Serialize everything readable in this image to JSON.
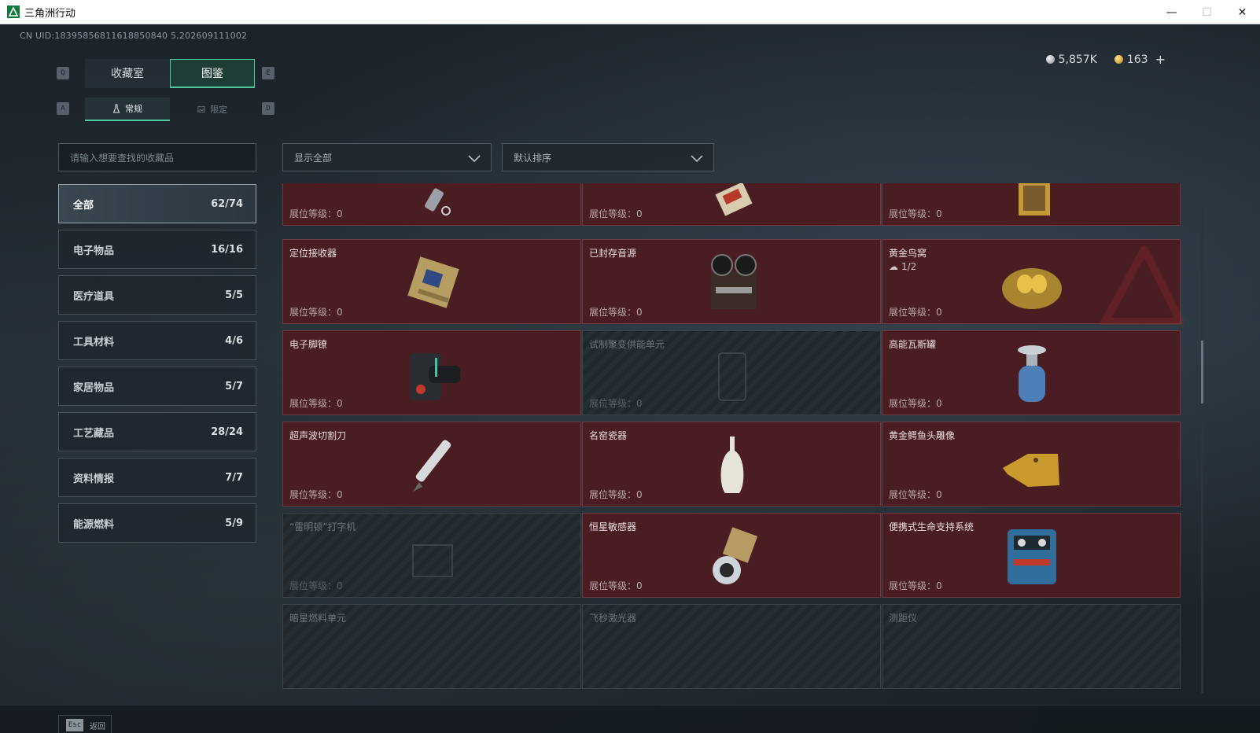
{
  "window": {
    "title": "三角洲行动",
    "minimize": "—",
    "maximize": "☐",
    "close": "✕"
  },
  "uid": "CN UID:18395856811618850840 5,202609111002",
  "currency": {
    "silver": "5,857K",
    "gold": "163",
    "plus": "+"
  },
  "keys": {
    "prev_tab": "Q",
    "next_tab": "E",
    "prev_sub": "A",
    "next_sub": "D",
    "esc": "Esc"
  },
  "tabs": [
    {
      "label": "收藏室"
    },
    {
      "label": "图鉴"
    }
  ],
  "subtabs": [
    {
      "label": "常规"
    },
    {
      "label": "限定"
    }
  ],
  "search": {
    "placeholder": "请输入想要查找的收藏品"
  },
  "filters": {
    "show": "显示全部",
    "sort": "默认排序"
  },
  "categories": [
    {
      "label": "全部",
      "count": "62/74"
    },
    {
      "label": "电子物品",
      "count": "16/16"
    },
    {
      "label": "医疗道具",
      "count": "5/5"
    },
    {
      "label": "工具材料",
      "count": "4/6"
    },
    {
      "label": "家居物品",
      "count": "5/7"
    },
    {
      "label": "工艺藏品",
      "count": "28/24"
    },
    {
      "label": "资料情报",
      "count": "7/7"
    },
    {
      "label": "能源燃料",
      "count": "5/9"
    }
  ],
  "items": [
    {
      "name": "",
      "level": "展位等级：0",
      "locked": false,
      "icon": "flashlight-icon"
    },
    {
      "name": "",
      "level": "展位等级：0",
      "locked": false,
      "icon": "card-icon"
    },
    {
      "name": "",
      "level": "展位等级：0",
      "locked": false,
      "icon": "painting-icon"
    },
    {
      "name": "定位接收器",
      "level": "展位等级：0",
      "locked": false,
      "icon": "receiver-icon"
    },
    {
      "name": "已封存音源",
      "level": "展位等级：0",
      "locked": false,
      "icon": "tape-recorder-icon"
    },
    {
      "name": "黄金鸟窝",
      "sub": "1/2",
      "level": "展位等级：0",
      "locked": false,
      "icon": "golden-nest-icon"
    },
    {
      "name": "电子脚镣",
      "level": "展位等级：0",
      "locked": false,
      "icon": "ankle-monitor-icon"
    },
    {
      "name": "试制聚变供能单元",
      "level": "展位等级：0",
      "locked": true,
      "icon": "fusion-cell-icon"
    },
    {
      "name": "高能瓦斯罐",
      "level": "展位等级：0",
      "locked": false,
      "icon": "gas-tank-icon"
    },
    {
      "name": "超声波切割刀",
      "level": "展位等级：0",
      "locked": false,
      "icon": "cutter-icon"
    },
    {
      "name": "名窑瓷器",
      "level": "展位等级：0",
      "locked": false,
      "icon": "porcelain-icon"
    },
    {
      "name": "黄金鳄鱼头雕像",
      "level": "展位等级：0",
      "locked": false,
      "icon": "golden-croc-icon"
    },
    {
      "name": "“雷明顿”打字机",
      "level": "展位等级：0",
      "locked": true,
      "icon": "typewriter-icon"
    },
    {
      "name": "恒星敏感器",
      "level": "展位等级：0",
      "locked": false,
      "icon": "star-sensor-icon"
    },
    {
      "name": "便携式生命支持系统",
      "level": "展位等级：0",
      "locked": false,
      "icon": "life-support-icon"
    },
    {
      "name": "暗星燃料单元",
      "level": "",
      "locked": true,
      "icon": "fuel-cell-icon"
    },
    {
      "name": "飞秒激光器",
      "level": "",
      "locked": true,
      "icon": "laser-icon"
    },
    {
      "name": "测距仪",
      "level": "",
      "locked": true,
      "icon": "rangefinder-icon"
    }
  ],
  "footer": {
    "back": "返回"
  }
}
